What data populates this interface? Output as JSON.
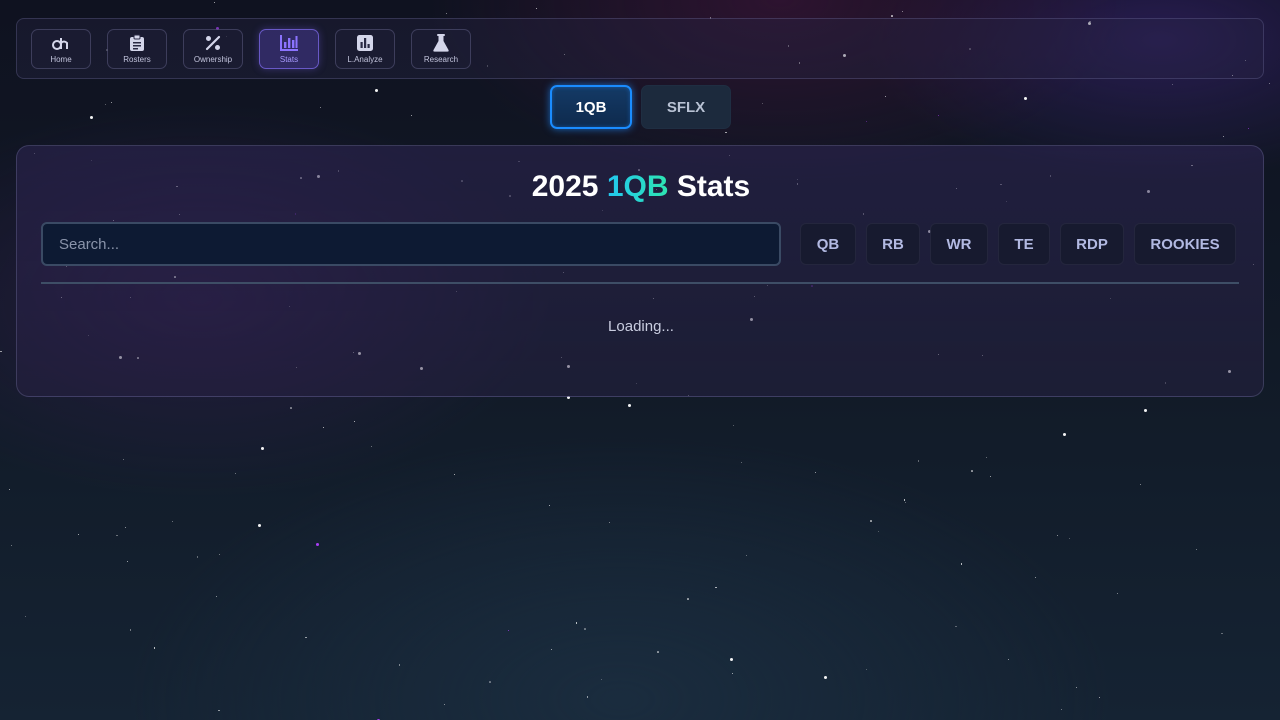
{
  "nav": {
    "items": [
      {
        "label": "Home",
        "icon": "dh-logo-icon"
      },
      {
        "label": "Rosters",
        "icon": "clipboard-icon"
      },
      {
        "label": "Ownership",
        "icon": "percent-icon"
      },
      {
        "label": "Stats",
        "icon": "bar-chart-icon",
        "active": true
      },
      {
        "label": "L.Analyze",
        "icon": "analyze-chart-icon"
      },
      {
        "label": "Research",
        "icon": "flask-icon"
      }
    ]
  },
  "toggle": {
    "options": [
      "1QB",
      "SFLX"
    ],
    "selected": "1QB"
  },
  "main": {
    "title_year": "2025",
    "title_format": "1QB",
    "title_suffix": "Stats",
    "search_placeholder": "Search...",
    "search_value": "",
    "filters": [
      "QB",
      "RB",
      "WR",
      "TE",
      "RDP",
      "ROOKIES"
    ],
    "loading_text": "Loading..."
  },
  "colors": {
    "accent_blue": "#1a8cff",
    "accent_purple": "#8b73ff",
    "title_gradient_start": "#22c7f0",
    "title_gradient_end": "#2ee6b0"
  }
}
